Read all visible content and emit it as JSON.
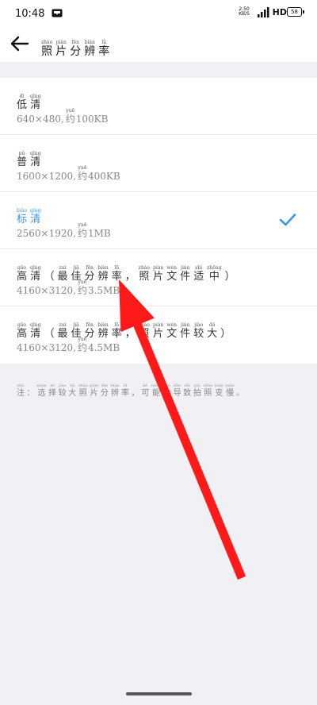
{
  "status_bar": {
    "time": "10:48",
    "net_speed_value": "2.50",
    "net_speed_unit": "KB/S",
    "network": "HD",
    "battery": "58"
  },
  "header": {
    "title_chars": [
      {
        "ch": "照",
        "py": "zhào"
      },
      {
        "ch": "片",
        "py": "piàn"
      },
      {
        "ch": "分",
        "py": "fēn"
      },
      {
        "ch": "辨",
        "py": "biàn"
      },
      {
        "ch": "率",
        "py": "lǜ"
      }
    ]
  },
  "options": [
    {
      "name_chars": [
        {
          "ch": "低",
          "py": "dī"
        },
        {
          "ch": "清",
          "py": "qīng"
        }
      ],
      "resolution": "640×480,",
      "approx": {
        "ch": "约",
        "py": "yuē"
      },
      "size": "100KB",
      "selected": false
    },
    {
      "name_chars": [
        {
          "ch": "普",
          "py": "pǔ"
        },
        {
          "ch": "清",
          "py": "qīng"
        }
      ],
      "resolution": "1600×1200,",
      "approx": {
        "ch": "约",
        "py": "yuē"
      },
      "size": "400KB",
      "selected": false
    },
    {
      "name_chars": [
        {
          "ch": "标",
          "py": "biāo"
        },
        {
          "ch": "清",
          "py": "qīng"
        }
      ],
      "resolution": "2560×1920,",
      "approx": {
        "ch": "约",
        "py": "yuē"
      },
      "size": "1MB",
      "selected": true
    },
    {
      "name_chars": [
        {
          "ch": "高",
          "py": "gāo"
        },
        {
          "ch": "清",
          "py": "qīng"
        },
        {
          "ch": "（",
          "py": ""
        },
        {
          "ch": "最",
          "py": "zuì"
        },
        {
          "ch": "佳",
          "py": "jiā"
        },
        {
          "ch": "分",
          "py": "fēn"
        },
        {
          "ch": "辨",
          "py": "biàn"
        },
        {
          "ch": "率",
          "py": "lǜ"
        },
        {
          "ch": "，",
          "py": ""
        },
        {
          "ch": "照",
          "py": "zhào"
        },
        {
          "ch": "片",
          "py": "piàn"
        },
        {
          "ch": "文",
          "py": "wén"
        },
        {
          "ch": "件",
          "py": "jiàn"
        },
        {
          "ch": "适",
          "py": "shì"
        },
        {
          "ch": "中",
          "py": "zhōng"
        },
        {
          "ch": "）",
          "py": ""
        }
      ],
      "resolution": "4160×3120,",
      "approx": {
        "ch": "约",
        "py": "yuē"
      },
      "size": "3.5MB",
      "selected": false
    },
    {
      "name_chars": [
        {
          "ch": "高",
          "py": "gāo"
        },
        {
          "ch": "清",
          "py": "qīng"
        },
        {
          "ch": "（",
          "py": ""
        },
        {
          "ch": "最",
          "py": "zuì"
        },
        {
          "ch": "佳",
          "py": "jiā"
        },
        {
          "ch": "分",
          "py": "fēn"
        },
        {
          "ch": "辨",
          "py": "biàn"
        },
        {
          "ch": "率",
          "py": "lǜ"
        },
        {
          "ch": "，",
          "py": ""
        },
        {
          "ch": "照",
          "py": "zhào"
        },
        {
          "ch": "片",
          "py": "piàn"
        },
        {
          "ch": "文",
          "py": "wén"
        },
        {
          "ch": "件",
          "py": "jiàn"
        },
        {
          "ch": "较",
          "py": "jiào"
        },
        {
          "ch": "大",
          "py": "dà"
        },
        {
          "ch": "）",
          "py": ""
        }
      ],
      "resolution": "4160×3120,",
      "approx": {
        "ch": "约",
        "py": "yuē"
      },
      "size": "4.5MB",
      "selected": false
    }
  ],
  "note_chars": [
    {
      "ch": "注",
      "py": "zhù"
    },
    {
      "ch": "：",
      "py": ""
    },
    {
      "ch": "选",
      "py": "xuǎn"
    },
    {
      "ch": "择",
      "py": "zé"
    },
    {
      "ch": "较",
      "py": "jiào"
    },
    {
      "ch": "大",
      "py": "dà"
    },
    {
      "ch": "照",
      "py": "zhào"
    },
    {
      "ch": "片",
      "py": "piàn"
    },
    {
      "ch": "分",
      "py": "fēn"
    },
    {
      "ch": "辨",
      "py": "biàn"
    },
    {
      "ch": "率",
      "py": "lǜ"
    },
    {
      "ch": "，",
      "py": ""
    },
    {
      "ch": "可",
      "py": "kě"
    },
    {
      "ch": "能",
      "py": "néng"
    },
    {
      "ch": "会",
      "py": "huì"
    },
    {
      "ch": "导",
      "py": "dǎo"
    },
    {
      "ch": "致",
      "py": "zhì"
    },
    {
      "ch": "拍",
      "py": "pāi"
    },
    {
      "ch": "照",
      "py": "zhào"
    },
    {
      "ch": "变",
      "py": "biàn"
    },
    {
      "ch": "慢",
      "py": "màn"
    },
    {
      "ch": "。",
      "py": ""
    }
  ],
  "colors": {
    "accent": "#3a9ae6",
    "annotation_arrow": "#ff1a1a"
  },
  "icons": {
    "back": "arrow-left-icon",
    "selected": "checkmark-icon",
    "message": "message-icon",
    "signal": "signal-icon",
    "battery": "battery-icon"
  }
}
